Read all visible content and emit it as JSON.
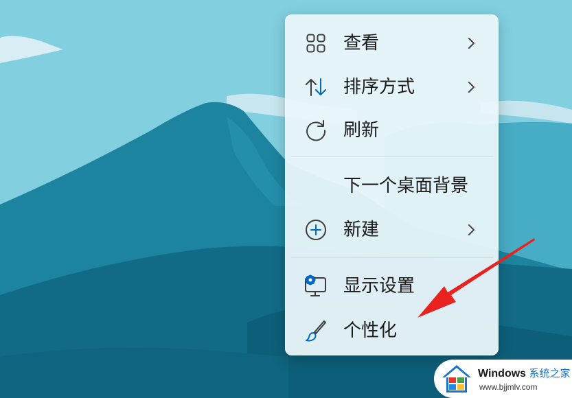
{
  "context_menu": {
    "items": [
      {
        "label": "查看",
        "icon": "grid-view-icon",
        "has_submenu": true
      },
      {
        "label": "排序方式",
        "icon": "sort-arrows-icon",
        "has_submenu": true
      },
      {
        "label": "刷新",
        "icon": "refresh-icon",
        "has_submenu": false
      },
      {
        "label": "下一个桌面背景",
        "icon": "",
        "has_submenu": false
      },
      {
        "label": "新建",
        "icon": "add-circle-icon",
        "has_submenu": true
      },
      {
        "label": "显示设置",
        "icon": "display-settings-icon",
        "has_submenu": false
      },
      {
        "label": "个性化",
        "icon": "paintbrush-icon",
        "has_submenu": false
      }
    ]
  },
  "watermark": {
    "title": "Windows",
    "suffix": "系统之家",
    "url": "www.bjjmlv.com"
  },
  "colors": {
    "accent": "#0067c0",
    "arrow": "#e8231f",
    "menu_background": "#eaf6fa"
  }
}
